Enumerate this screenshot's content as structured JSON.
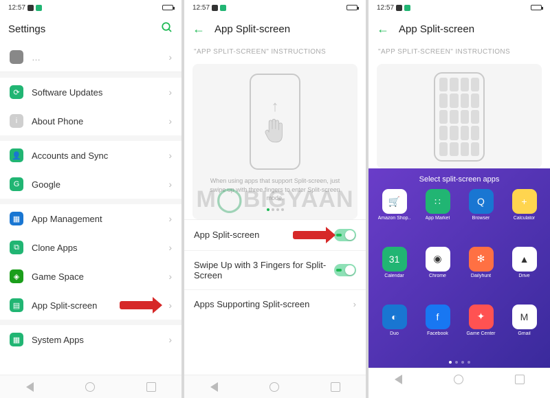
{
  "statusbar": {
    "time": "12:57"
  },
  "phone1": {
    "header": {
      "title": "Settings"
    },
    "items": [
      {
        "label": "Software Updates",
        "icon_bg": "#21b573"
      },
      {
        "label": "About Phone",
        "icon_bg": "#cfcfcf"
      }
    ],
    "items2": [
      {
        "label": "Accounts and Sync",
        "icon_bg": "#21b573"
      },
      {
        "label": "Google",
        "icon_bg": "#21b573",
        "icon_txt": "G"
      }
    ],
    "items3": [
      {
        "label": "App Management",
        "icon_bg": "#1976d2"
      },
      {
        "label": "Clone Apps",
        "icon_bg": "#21b573"
      },
      {
        "label": "Game Space",
        "icon_bg": "#1b9e1b"
      },
      {
        "label": "App Split-screen",
        "icon_bg": "#21b573"
      }
    ],
    "items4": [
      {
        "label": "System Apps",
        "icon_bg": "#21b573"
      }
    ]
  },
  "phone2": {
    "header": {
      "title": "App Split-screen"
    },
    "sub": "\"APP SPLIT-SCREEN\" INSTRUCTIONS",
    "hint": "When using apps that support Split-screen, just swipe up with three fingers to enter Split-screen mode.",
    "rows": [
      {
        "label": "App Split-screen",
        "toggle": true
      },
      {
        "label": "Swipe Up with 3 Fingers for Split-Screen",
        "toggle": true
      },
      {
        "label": "Apps Supporting Split-screen",
        "chevron": true
      }
    ]
  },
  "phone3": {
    "header": {
      "title": "App Split-screen"
    },
    "sub": "\"APP SPLIT-SCREEN\" INSTRUCTIONS",
    "half_title": "Select split-screen apps",
    "apps": [
      {
        "label": "Amazon Shop..",
        "bg": "#fff",
        "txt": "🛒"
      },
      {
        "label": "App Market",
        "bg": "#21b573",
        "txt": "∷"
      },
      {
        "label": "Browser",
        "bg": "#1976d2",
        "txt": "Q"
      },
      {
        "label": "Calculator",
        "bg": "#ffd54f",
        "txt": "+"
      },
      {
        "label": "Calendar",
        "bg": "#21b573",
        "txt": "31"
      },
      {
        "label": "Chrome",
        "bg": "#fff",
        "txt": "◉"
      },
      {
        "label": "Dailyhunt",
        "bg": "#ff7043",
        "txt": "✻"
      },
      {
        "label": "Drive",
        "bg": "#fff",
        "txt": "▲"
      },
      {
        "label": "Duo",
        "bg": "#1976d2",
        "txt": "◐"
      },
      {
        "label": "Facebook",
        "bg": "#1877f2",
        "txt": "f"
      },
      {
        "label": "Game Center",
        "bg": "#ff5252",
        "txt": "✦"
      },
      {
        "label": "Gmail",
        "bg": "#fff",
        "txt": "M"
      }
    ]
  },
  "watermark": "M   BIGYAAN"
}
